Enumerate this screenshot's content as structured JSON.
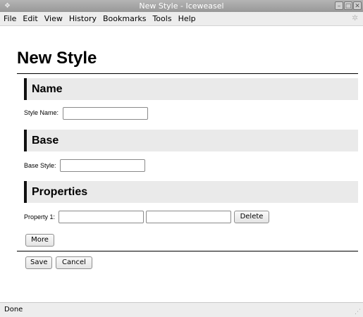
{
  "window": {
    "title": "New Style - Iceweasel",
    "app_icon": "iceweasel-icon",
    "controls": [
      "minimize-icon",
      "maximize-icon",
      "close-icon"
    ]
  },
  "menubar": {
    "items": [
      "File",
      "Edit",
      "View",
      "History",
      "Bookmarks",
      "Tools",
      "Help"
    ]
  },
  "page": {
    "title": "New Style",
    "sections": {
      "name": {
        "heading": "Name",
        "field_label": "Style Name:",
        "field_value": ""
      },
      "base": {
        "heading": "Base",
        "field_label": "Base Style:",
        "field_value": ""
      },
      "properties": {
        "heading": "Properties",
        "field_label": "Property 1:",
        "key_value": "",
        "value_value": "",
        "delete_label": "Delete",
        "more_label": "More"
      }
    },
    "actions": {
      "save_label": "Save",
      "cancel_label": "Cancel"
    }
  },
  "statusbar": {
    "text": "Done"
  }
}
